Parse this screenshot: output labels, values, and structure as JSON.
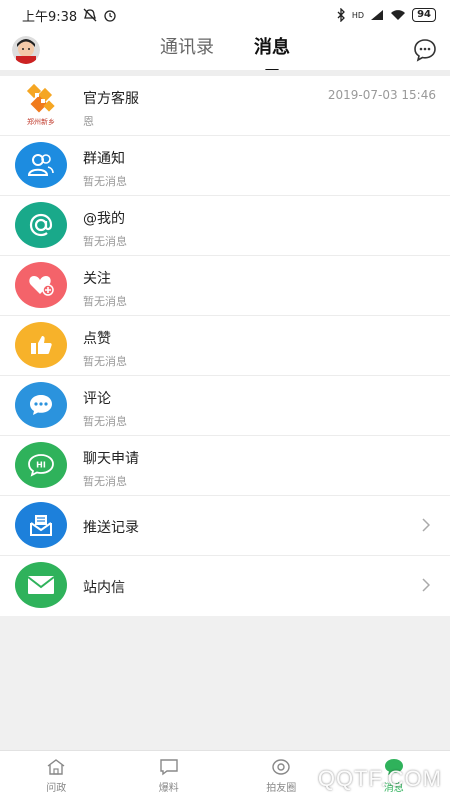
{
  "status": {
    "time": "上午9:38",
    "network_label": "HD",
    "battery": "94"
  },
  "header": {
    "tabs": [
      {
        "label": "通讯录",
        "active": false
      },
      {
        "label": "消息",
        "active": true
      }
    ]
  },
  "messages": [
    {
      "title": "官方客服",
      "subtitle": "恩",
      "time": "2019-07-03 15:46",
      "icon": "service-logo-icon",
      "color": "#ffffff"
    },
    {
      "title": "群通知",
      "subtitle": "暂无消息",
      "icon": "group-icon",
      "color": "#1d8ce0"
    },
    {
      "title": "@我的",
      "subtitle": "暂无消息",
      "icon": "at-icon",
      "color": "#19a98a"
    },
    {
      "title": "关注",
      "subtitle": "暂无消息",
      "icon": "heart-plus-icon",
      "color": "#f4636a"
    },
    {
      "title": "点赞",
      "subtitle": "暂无消息",
      "icon": "thumbs-up-icon",
      "color": "#f7b22a"
    },
    {
      "title": "评论",
      "subtitle": "暂无消息",
      "icon": "comment-icon",
      "color": "#2b93dd"
    },
    {
      "title": "聊天申请",
      "subtitle": "暂无消息",
      "icon": "hi-chat-icon",
      "color": "#2fb25b",
      "icon_text": "HI"
    },
    {
      "title": "推送记录",
      "icon": "inbox-icon",
      "color": "#1d80db"
    },
    {
      "title": "站内信",
      "icon": "mail-icon",
      "color": "#2fb25b"
    }
  ],
  "bottom_nav": [
    {
      "label": "问政",
      "icon": "home-icon",
      "active": false
    },
    {
      "label": "爆料",
      "icon": "report-icon",
      "active": false
    },
    {
      "label": "拍友圈",
      "icon": "camera-circle-icon",
      "active": false
    },
    {
      "label": "消息",
      "icon": "message-icon",
      "active": true
    }
  ],
  "watermark": "QQTF.COM",
  "service_logo_text": "郑州新乡"
}
